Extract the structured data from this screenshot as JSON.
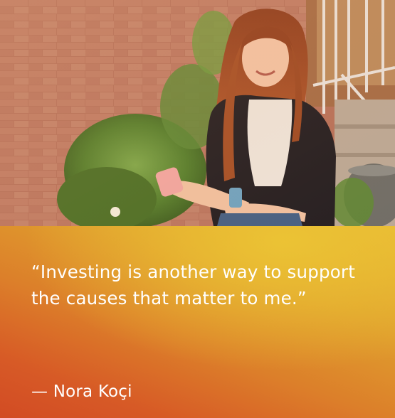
{
  "quote": {
    "text": "“Investing is another way to support the causes that matter to me.”",
    "attribution": "— Nora Koçi"
  },
  "colors": {
    "panel_top": "#e7b734",
    "panel_bottom": "#d24b24",
    "quote_text": "#ffffff"
  }
}
